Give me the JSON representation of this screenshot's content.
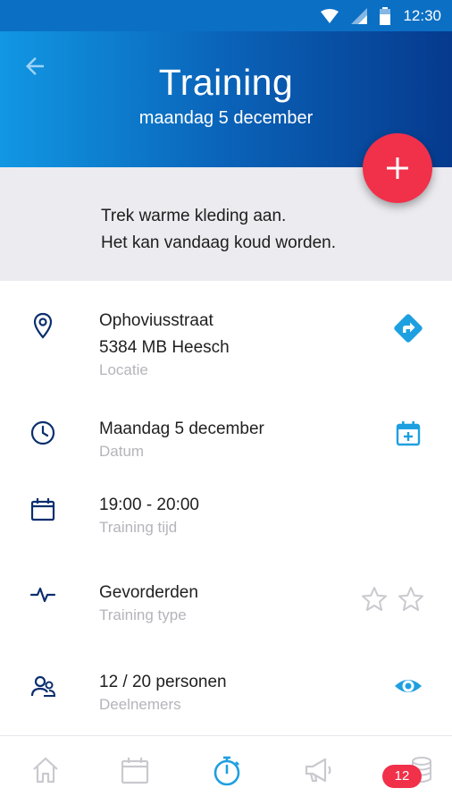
{
  "status_bar": {
    "time": "12:30"
  },
  "header": {
    "title": "Training",
    "subtitle": "maandag 5 december"
  },
  "notice": {
    "line1": "Trek warme kleding aan.",
    "line2": "Het kan vandaag koud worden."
  },
  "details": {
    "location": {
      "street": "Ophoviusstraat",
      "city": "5384 MB Heesch",
      "label": "Locatie"
    },
    "date": {
      "value": "Maandag 5 december",
      "label": "Datum"
    },
    "time": {
      "value": "19:00 - 20:00",
      "label": "Training tijd"
    },
    "type": {
      "value": "Gevorderden",
      "label": "Training type",
      "rating": 0,
      "rating_max": 2
    },
    "participants": {
      "value": "12 / 20 personen",
      "label": "Deelnemers"
    }
  },
  "bottom_nav": {
    "active": "timer",
    "badge_count": "12"
  },
  "colors": {
    "accent": "#1ea0e0",
    "fab": "#f1304a",
    "icon_dark": "#0b2f6e",
    "inactive": "#c9c9cf"
  }
}
